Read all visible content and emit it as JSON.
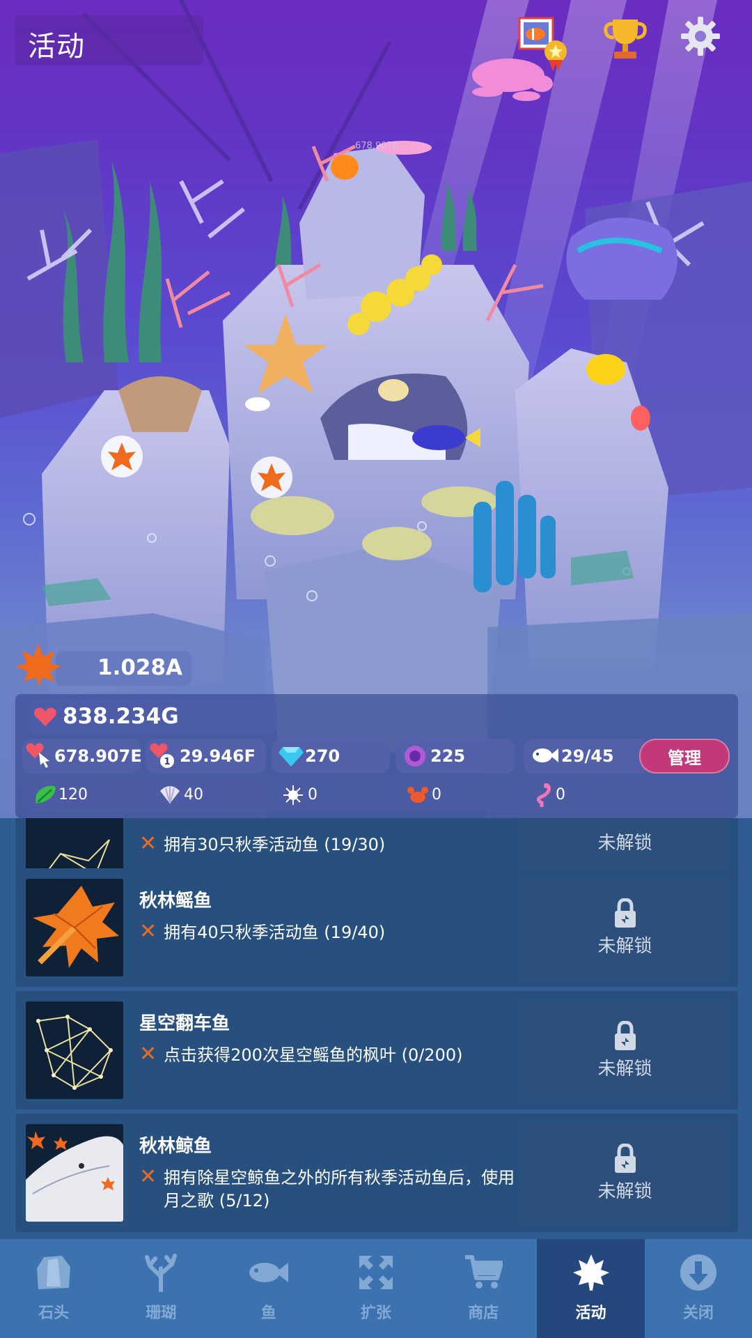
{
  "header": {
    "title": "活动",
    "icons": [
      "photo-badge-icon",
      "trophy-icon",
      "gear-icon"
    ]
  },
  "scene": {
    "floating_label": "678.907E"
  },
  "resources": {
    "maple_leaves": "1.028A",
    "hearts": "838.234G",
    "hearts_per_tap": "678.907E",
    "hearts_per_sec": "29.946F",
    "diamonds": "270",
    "pearls": "225",
    "fish_count": "29/45",
    "manage_label": "管理",
    "materials": [
      {
        "icon": "green-leaf-icon",
        "value": "120"
      },
      {
        "icon": "shell-icon",
        "value": "40"
      },
      {
        "icon": "urchin-icon",
        "value": "0"
      },
      {
        "icon": "crab-icon",
        "value": "0"
      },
      {
        "icon": "flamingo-icon",
        "value": "0"
      }
    ]
  },
  "achievements": [
    {
      "name": "",
      "condition": "拥有30只秋季活动鱼 (19/30)",
      "status": "未解锁"
    },
    {
      "name": "秋林鳐鱼",
      "condition": "拥有40只秋季活动鱼 (19/40)",
      "status": "未解锁"
    },
    {
      "name": "星空翻车鱼",
      "condition": "点击获得200次星空鳐鱼的枫叶 (0/200)",
      "status": "未解锁"
    },
    {
      "name": "秋林鲸鱼",
      "condition": "拥有除星空鲸鱼之外的所有秋季活动鱼后，使用月之歌 (5/12)",
      "status": "未解锁"
    }
  ],
  "nav": {
    "items": [
      {
        "label": "石头",
        "icon": "rock-icon"
      },
      {
        "label": "珊瑚",
        "icon": "coral-icon"
      },
      {
        "label": "鱼",
        "icon": "fish-icon"
      },
      {
        "label": "扩张",
        "icon": "expand-icon"
      },
      {
        "label": "商店",
        "icon": "cart-icon"
      },
      {
        "label": "活动",
        "icon": "maple-leaf-icon"
      },
      {
        "label": "关闭",
        "icon": "close-down-icon"
      }
    ],
    "active_index": 5
  },
  "colors": {
    "accent_manage": "#c2397a",
    "maple_orange": "#f06a1e",
    "nav_bg": "#3d72b1",
    "nav_active_bg": "#24487e"
  }
}
